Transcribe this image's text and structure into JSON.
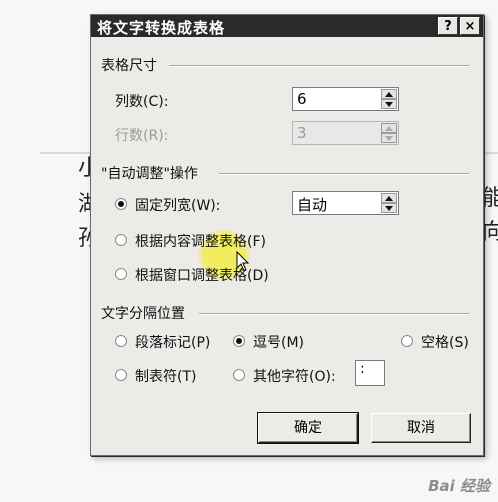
{
  "background_doc": {
    "chars": [
      "小",
      "湖",
      "孙",
      "能",
      "向"
    ]
  },
  "dialog": {
    "title": "将文字转换成表格",
    "help_button": "?",
    "close_button": "×",
    "table_size": {
      "group_label": "表格尺寸",
      "columns_label": "列数(C):",
      "columns_value": "6",
      "rows_label": "行数(R):",
      "rows_value": "3"
    },
    "autofit": {
      "group_label": "\"自动调整\"操作",
      "fixed_width_label": "固定列宽(W):",
      "fixed_width_value": "自动",
      "fit_content_label": "根据内容调整表格(F)",
      "fit_window_label": "根据窗口调整表格(D)",
      "selected": "fixed_width"
    },
    "separator": {
      "group_label": "文字分隔位置",
      "paragraph_label": "段落标记(P)",
      "comma_label": "逗号(M)",
      "space_label": "空格(S)",
      "tab_label": "制表符(T)",
      "other_label": "其他字符(O):",
      "other_value": ":",
      "selected": "comma"
    },
    "ok_button": "确定",
    "cancel_button": "取消"
  },
  "watermark": "Bai 经验",
  "colors": {
    "titlebar": "#2a2a2a",
    "dialog_bg": "#ecebe8",
    "highlight": "#f0ec50"
  }
}
